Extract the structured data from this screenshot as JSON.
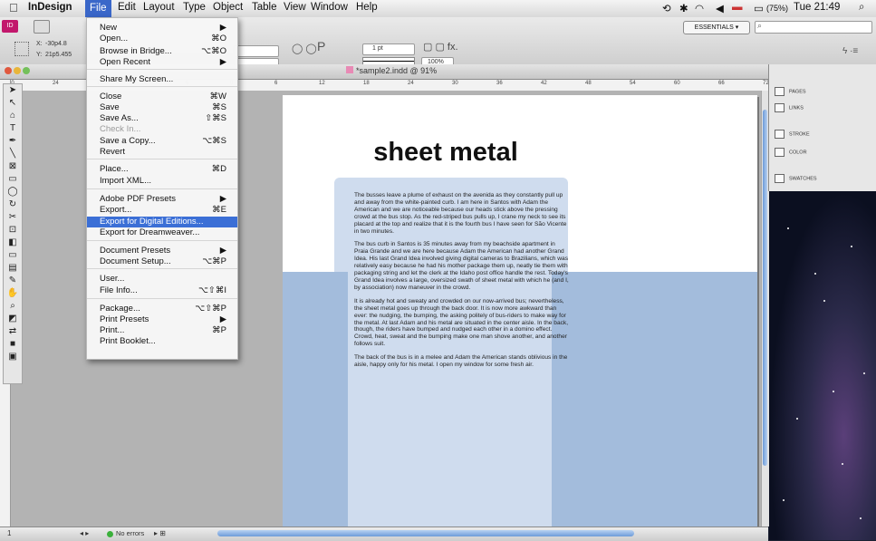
{
  "menubar": {
    "app": "InDesign",
    "items": [
      "File",
      "Edit",
      "Layout",
      "Type",
      "Object",
      "Table",
      "View",
      "Window",
      "Help"
    ],
    "battery": "(75%)",
    "clock": "Tue 21:49",
    "workspace": "ESSENTIALS ▾"
  },
  "control": {
    "x_value": "-30p4.8",
    "y_value": "21p5.455",
    "stroke_weight": "1 pt",
    "zoom_percent": "100%"
  },
  "document": {
    "tab_title": "*sample2.indd @ 91%",
    "ruler_ticks": [
      "36",
      "30",
      "24",
      "18",
      "12",
      "6",
      "0",
      "6",
      "12",
      "18",
      "24",
      "30",
      "36",
      "42",
      "48",
      "54",
      "60",
      "66",
      "72"
    ],
    "headline": "sheet metal",
    "paragraphs": [
      "The busses leave a plume of exhaust on the avenida as they constantly pull up and away from the white-painted curb. I am here in Santos with Adam the American and we are noticeable because our heads stick above the pressing crowd at the bus stop. As the red-striped bus pulls up, I crane my neck to see its placard at the top and realize that it is the fourth bus I have seen for São Vicente in two minutes.",
      "The bus curb in Santos is 35 minutes away from my beachside apartment in Praia Grande and we are here because Adam the American had another Grand Idea. His last Grand Idea involved giving digital cameras to Brazilians, which was relatively easy because he had his mother package them up, neatly tie them with packaging string and let the clerk at the Idaho post office handle the rest. Today's Grand Idea involves a large, oversized swath of sheet metal with which he (and I, by association) now maneuver in the crowd.",
      "It is already hot and sweaty and crowded on our now-arrived bus; nevertheless, the sheet metal goes up through the back door. It is now more awkward than ever: the nudging, the bumping, the asking politely of bus-riders to make way for the metal. At last Adam and his metal are situated in the center aisle. In the back, though, the riders have bumped and nudged each other in a domino effect. Crowd, heat, sweat and the bumping make one man shove another, and another follows suit.",
      "The back of the bus is in a melee and Adam the American stands oblivious in the aisle, happy only for his metal. I open my window for some fresh air."
    ]
  },
  "status": {
    "page": "1",
    "errors": "No errors"
  },
  "panels": [
    "PAGES",
    "LINKS",
    "STROKE",
    "COLOR",
    "SWATCHES"
  ],
  "file_menu": [
    {
      "label": "New",
      "shortcut": "▶"
    },
    {
      "label": "Open...",
      "shortcut": "⌘O"
    },
    {
      "label": "Browse in Bridge...",
      "shortcut": "⌥⌘O"
    },
    {
      "label": "Open Recent",
      "shortcut": "▶"
    },
    {
      "label": "Share My Screen...",
      "shortcut": ""
    },
    {
      "label": "Close",
      "shortcut": "⌘W"
    },
    {
      "label": "Save",
      "shortcut": "⌘S"
    },
    {
      "label": "Save As...",
      "shortcut": "⇧⌘S"
    },
    {
      "label": "Check In...",
      "shortcut": ""
    },
    {
      "label": "Save a Copy...",
      "shortcut": "⌥⌘S"
    },
    {
      "label": "Revert",
      "shortcut": ""
    },
    {
      "label": "Place...",
      "shortcut": "⌘D"
    },
    {
      "label": "Import XML...",
      "shortcut": ""
    },
    {
      "label": "Adobe PDF Presets",
      "shortcut": "▶"
    },
    {
      "label": "Export...",
      "shortcut": "⌘E"
    },
    {
      "label": "Export for Digital Editions...",
      "shortcut": ""
    },
    {
      "label": "Export for Dreamweaver...",
      "shortcut": ""
    },
    {
      "label": "Document Presets",
      "shortcut": "▶"
    },
    {
      "label": "Document Setup...",
      "shortcut": "⌥⌘P"
    },
    {
      "label": "User...",
      "shortcut": ""
    },
    {
      "label": "File Info...",
      "shortcut": "⌥⇧⌘I"
    },
    {
      "label": "Package...",
      "shortcut": "⌥⇧⌘P"
    },
    {
      "label": "Print Presets",
      "shortcut": "▶"
    },
    {
      "label": "Print...",
      "shortcut": "⌘P"
    },
    {
      "label": "Print Booklet...",
      "shortcut": ""
    }
  ]
}
